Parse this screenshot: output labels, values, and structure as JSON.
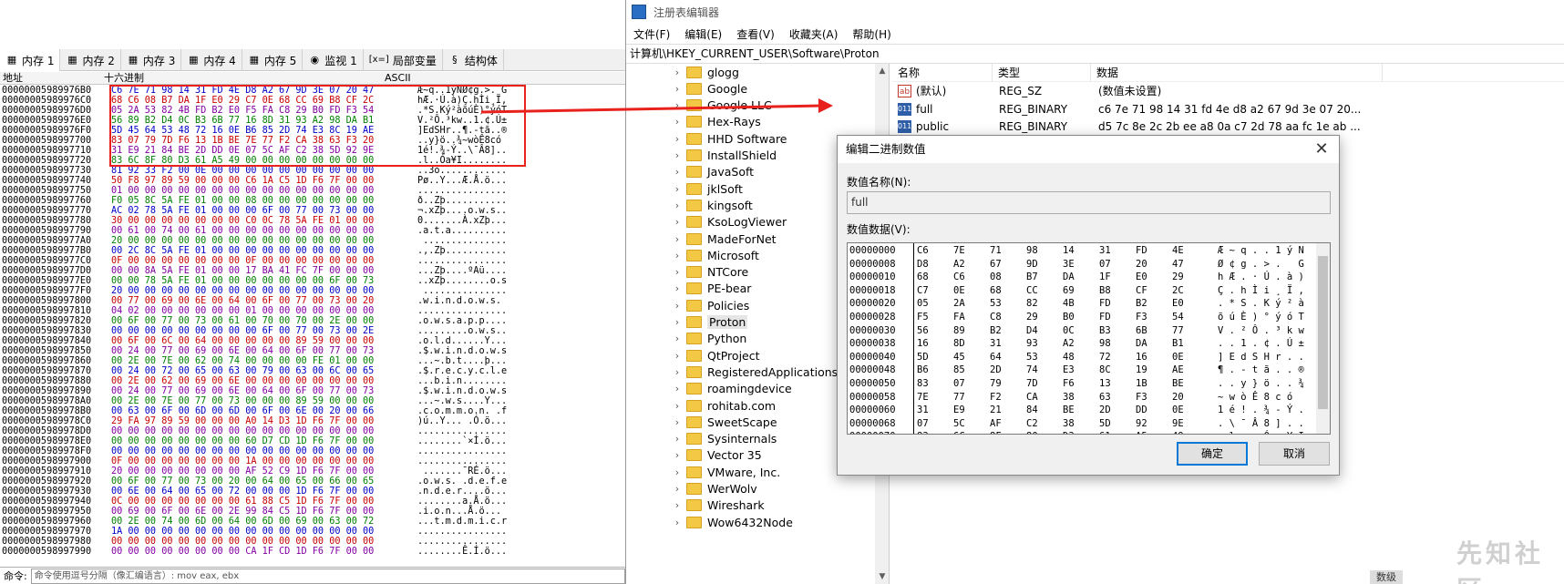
{
  "debugger": {
    "tabs": [
      {
        "label": "内存 1",
        "icon": "memory-icon",
        "active": true
      },
      {
        "label": "内存 2",
        "icon": "memory-icon"
      },
      {
        "label": "内存 3",
        "icon": "memory-icon"
      },
      {
        "label": "内存 4",
        "icon": "memory-icon"
      },
      {
        "label": "内存 5",
        "icon": "memory-icon"
      },
      {
        "label": "监视 1",
        "icon": "watch-icon"
      },
      {
        "label": "局部变量",
        "icon": "locals-icon",
        "prefix": "[x=]"
      },
      {
        "label": "结构体",
        "icon": "struct-icon"
      }
    ],
    "columns": {
      "address": "地址",
      "hex": "十六进制",
      "ascii": "ASCII"
    },
    "rows": [
      {
        "addr": "00000005989976B0",
        "hex": "C6 7E 71 98 14 31 FD 4E D8 A2 67 9D 3E 07 20 47",
        "ascii": "Æ~q..1ýNØ¢g.>. G"
      },
      {
        "addr": "00000005989976C0",
        "hex": "68 C6 08 B7 DA 1F E0 29 C7 0E 68 CC 69 B8 CF 2C",
        "ascii": "hÆ.·Ú.à)Ç.hÌi¸Ï,"
      },
      {
        "addr": "00000005989976D0",
        "hex": "05 2A 53 82 4B FD B2 E0 F5 FA C8 29 B0 FD F3 54",
        "ascii": ".*S.Ký²àõúÈ)°ýóT"
      },
      {
        "addr": "00000005989976E0",
        "hex": "56 89 B2 D4 0C B3 6B 77 16 8D 31 93 A2 98 DA B1",
        "ascii": "V.²Ô.³kw..1.¢.Ú±"
      },
      {
        "addr": "00000005989976F0",
        "hex": "5D 45 64 53 48 72 16 0E B6 85 2D 74 E3 8C 19 AE",
        "ascii": "]EdSHr..¶.-tã..®"
      },
      {
        "addr": "0000000598997700",
        "hex": "83 07 79 7D F6 13 1B BE 7E 77 F2 CA 38 63 F3 20",
        "ascii": "..y}ö..¾~wòÊ8có "
      },
      {
        "addr": "0000000598997710",
        "hex": "31 E9 21 84 BE 2D DD 0E 07 5C AF C2 38 5D 92 9E",
        "ascii": "1é!.¾-Ý..\\¯Â8].."
      },
      {
        "addr": "0000000598997720",
        "hex": "83 6C 8F 80 D3 61 A5 49 00 00 00 00 00 00 00 00",
        "ascii": ".l..Óa¥I........"
      },
      {
        "addr": "0000000598997730",
        "hex": "81 92 33 F2 00 0E 00 00 00 00 00 00 00 00 00 00",
        "ascii": "..3ò............"
      },
      {
        "addr": "0000000598997740",
        "hex": "50 F8 97 89 59 00 00 00 C6 1A C5 1D F6 7F 00 00",
        "ascii": "Pø..Y...Æ.Å.ö..."
      },
      {
        "addr": "0000000598997750",
        "hex": "01 00 00 00 00 00 00 00 00 00 00 00 00 00 00 00",
        "ascii": "................"
      },
      {
        "addr": "0000000598997760",
        "hex": "F0 05 8C 5A FE 01 00 00 08 00 00 00 00 00 00 00",
        "ascii": "ð..Zþ..........."
      },
      {
        "addr": "0000000598997770",
        "hex": "AC 02 78 5A FE 01 00 00 00 6F 00 77 00 73 00 00",
        "ascii": "¬.xZþ....o.w.s.."
      },
      {
        "addr": "0000000598997780",
        "hex": "30 00 00 00 00 00 00 00 C0 0C 78 5A FE 01 00 00",
        "ascii": "0.......À.xZþ..."
      },
      {
        "addr": "0000000598997790",
        "hex": "00 61 00 74 00 61 00 00 00 00 00 00 00 00 00 00",
        "ascii": ".a.t.a.........."
      },
      {
        "addr": "00000005989977A0",
        "hex": "20 00 00 00 00 00 00 00 00 00 00 00 00 00 00 00",
        "ascii": " ..............."
      },
      {
        "addr": "00000005989977B0",
        "hex": "00 2C 8C 5A FE 01 00 00 00 00 00 00 00 00 00 00",
        "ascii": ".,.Zþ..........."
      },
      {
        "addr": "00000005989977C0",
        "hex": "0F 00 00 00 00 00 00 00 0F 00 00 00 00 00 00 00",
        "ascii": "................"
      },
      {
        "addr": "00000005989977D0",
        "hex": "00 00 8A 5A FE 01 00 00 17 BA 41 FC 7F 00 00 00",
        "ascii": "...Zþ....ºAü...."
      },
      {
        "addr": "00000005989977E0",
        "hex": "00 00 78 5A FE 01 00 00 00 00 00 00 00 6F 00 73",
        "ascii": "..xZþ........o.s"
      },
      {
        "addr": "00000005989977F0",
        "hex": "20 00 00 00 00 00 00 00 00 00 00 00 00 00 00 00",
        "ascii": " ..............."
      },
      {
        "addr": "0000000598997800",
        "hex": "00 77 00 69 00 6E 00 64 00 6F 00 77 00 73 00 20",
        "ascii": ".w.i.n.d.o.w.s. "
      },
      {
        "addr": "0000000598997810",
        "hex": "04 02 00 00 00 00 00 00 01 00 00 00 00 00 00 00",
        "ascii": "................"
      },
      {
        "addr": "0000000598997820",
        "hex": "00 6F 00 77 00 73 00 61 00 70 00 70 00 2E 00 00",
        "ascii": ".o.w.s.a.p.p...."
      },
      {
        "addr": "0000000598997830",
        "hex": "00 00 00 00 00 00 00 00 00 6F 00 77 00 73 00 2E",
        "ascii": ".........o.w.s.."
      },
      {
        "addr": "0000000598997840",
        "hex": "00 6F 00 6C 00 64 00 00 00 00 00 89 59 00 00 00",
        "ascii": ".o.l.d......Y..."
      },
      {
        "addr": "0000000598997850",
        "hex": "00 24 00 77 00 69 00 6E 00 64 00 6F 00 77 00 73",
        "ascii": ".$.w.i.n.d.o.w.s"
      },
      {
        "addr": "0000000598997860",
        "hex": "00 2E 00 7E 00 62 00 74 00 00 00 00 FE 01 00 00",
        "ascii": "...~.b.t....þ..."
      },
      {
        "addr": "0000000598997870",
        "hex": "00 24 00 72 00 65 00 63 00 79 00 63 00 6C 00 65",
        "ascii": ".$.r.e.c.y.c.l.e"
      },
      {
        "addr": "0000000598997880",
        "hex": "00 2E 00 62 00 69 00 6E 00 00 00 00 00 00 00 00",
        "ascii": "...b.i.n........"
      },
      {
        "addr": "0000000598997890",
        "hex": "00 24 00 77 00 69 00 6E 00 64 00 6F 00 77 00 73",
        "ascii": ".$.w.i.n.d.o.w.s"
      },
      {
        "addr": "00000005989978A0",
        "hex": "00 2E 00 7E 00 77 00 73 00 00 00 89 59 00 00 00",
        "ascii": "...~.w.s....Y..."
      },
      {
        "addr": "00000005989978B0",
        "hex": "00 63 00 6F 00 6D 00 6D 00 6F 00 6E 00 20 00 66",
        "ascii": ".c.o.m.m.o.n. .f"
      },
      {
        "addr": "00000005989978C0",
        "hex": "29 FA 97 89 59 00 00 00 A0 14 D3 1D F6 7F 00 00",
        "ascii": ")ú..Y... .Ó.ö..."
      },
      {
        "addr": "00000005989978D0",
        "hex": "00 00 00 00 00 00 00 00 00 00 00 00 00 00 00 00",
        "ascii": "................"
      },
      {
        "addr": "00000005989978E0",
        "hex": "00 00 00 00 00 00 00 00 60 D7 CD 1D F6 7F 00 00",
        "ascii": "........`×Í.ö..."
      },
      {
        "addr": "00000005989978F0",
        "hex": "00 00 00 00 00 00 00 00 00 00 00 00 00 00 00 00",
        "ascii": "................"
      },
      {
        "addr": "0000000598997900",
        "hex": "0F 00 00 00 00 00 00 00 1A 00 00 00 00 00 00 00",
        "ascii": "................"
      },
      {
        "addr": "0000000598997910",
        "hex": "20 00 00 00 00 00 00 00 AF 52 C9 1D F6 7F 00 00",
        "ascii": " .......¯RÉ.ö..."
      },
      {
        "addr": "0000000598997920",
        "hex": "00 6F 00 77 00 73 00 20 00 64 00 65 00 66 00 65",
        "ascii": ".o.w.s. .d.e.f.e"
      },
      {
        "addr": "0000000598997930",
        "hex": "00 6E 00 64 00 65 00 72 00 00 00 1D F6 7F 00 00",
        "ascii": ".n.d.e.r....ö..."
      },
      {
        "addr": "0000000598997940",
        "hex": "0C 00 00 00 00 00 00 00 61 88 C5 1D F6 7F 00 00",
        "ascii": "........a.Å.ö..."
      },
      {
        "addr": "0000000598997950",
        "hex": "00 69 00 6F 00 6E 00 2E 99 84 C5 1D F6 7F 00 00",
        "ascii": ".i.o.n...Å.ö..."
      },
      {
        "addr": "0000000598997960",
        "hex": "00 2E 00 74 00 6D 00 64 00 6D 00 69 00 63 00 72",
        "ascii": "...t.m.d.m.i.c.r"
      },
      {
        "addr": "0000000598997970",
        "hex": "1A 00 00 00 00 00 00 00 00 00 00 00 00 00 00 00",
        "ascii": "................"
      },
      {
        "addr": "0000000598997980",
        "hex": "00 00 00 00 00 00 00 00 00 00 00 00 00 00 00 00",
        "ascii": "................"
      },
      {
        "addr": "0000000598997990",
        "hex": "00 00 00 00 00 00 00 00 CA 1F CD 1D F6 7F 00 00",
        "ascii": "........Ê.Í.ö..."
      }
    ],
    "command_label": "命令:",
    "command_placeholder": "命令使用逗号分隔（像汇编语言）: mov eax, ebx"
  },
  "regedit": {
    "title": "注册表编辑器",
    "menu": [
      "文件(F)",
      "编辑(E)",
      "查看(V)",
      "收藏夹(A)",
      "帮助(H)"
    ],
    "address": "计算机\\HKEY_CURRENT_USER\\Software\\Proton",
    "tree": [
      "glogg",
      "Google",
      "Google LLC",
      "Hex-Rays",
      "HHD Software",
      "InstallShield",
      "JavaSoft",
      "jklSoft",
      "kingsoft",
      "KsoLogViewer",
      "MadeForNet",
      "Microsoft",
      "NTCore",
      "PE-bear",
      "Policies",
      "Proton",
      "Python",
      "QtProject",
      "RegisteredApplications",
      "roamingdevice",
      "rohitab.com",
      "SweetScape",
      "Sysinternals",
      "Vector 35",
      "VMware, Inc.",
      "WerWolv",
      "Wireshark",
      "Wow6432Node"
    ],
    "selected_tree": "Proton",
    "list_headers": {
      "name": "名称",
      "type": "类型",
      "data": "数据"
    },
    "values": [
      {
        "name": "(默认)",
        "type": "REG_SZ",
        "data": "(数值未设置)",
        "icon": "string-value-icon"
      },
      {
        "name": "full",
        "type": "REG_BINARY",
        "data": "c6 7e 71 98 14 31 fd 4e d8 a2 67 9d 3e 07 20...",
        "icon": "binary-value-icon"
      },
      {
        "name": "public",
        "type": "REG_BINARY",
        "data": "d5 7c 8e 2c 2b ee a8 0a c7 2d 78 aa fc 1e ab ...",
        "icon": "binary-value-icon"
      }
    ]
  },
  "dialog": {
    "title": "编辑二进制数值",
    "name_label": "数值名称(N):",
    "name_value": "full",
    "data_label": "数值数据(V):",
    "hex_rows": [
      {
        "offset": "00000000",
        "bytes": [
          "C6",
          "7E",
          "71",
          "98",
          "14",
          "31",
          "FD",
          "4E"
        ],
        "ascii": "Æ ~ q . . 1 ý N"
      },
      {
        "offset": "00000008",
        "bytes": [
          "D8",
          "A2",
          "67",
          "9D",
          "3E",
          "07",
          "20",
          "47"
        ],
        "ascii": "Ø ¢ g . > .   G"
      },
      {
        "offset": "00000010",
        "bytes": [
          "68",
          "C6",
          "08",
          "B7",
          "DA",
          "1F",
          "E0",
          "29"
        ],
        "ascii": "h Æ . · Ú . à )"
      },
      {
        "offset": "00000018",
        "bytes": [
          "C7",
          "0E",
          "68",
          "CC",
          "69",
          "B8",
          "CF",
          "2C"
        ],
        "ascii": "Ç . h Ì i ¸ Ï ,"
      },
      {
        "offset": "00000020",
        "bytes": [
          "05",
          "2A",
          "53",
          "82",
          "4B",
          "FD",
          "B2",
          "E0"
        ],
        "ascii": ". * S . K ý ² à"
      },
      {
        "offset": "00000028",
        "bytes": [
          "F5",
          "FA",
          "C8",
          "29",
          "B0",
          "FD",
          "F3",
          "54"
        ],
        "ascii": "õ ú È ) ° ý ó T"
      },
      {
        "offset": "00000030",
        "bytes": [
          "56",
          "89",
          "B2",
          "D4",
          "0C",
          "B3",
          "6B",
          "77"
        ],
        "ascii": "V . ² Ô . ³ k w"
      },
      {
        "offset": "00000038",
        "bytes": [
          "16",
          "8D",
          "31",
          "93",
          "A2",
          "98",
          "DA",
          "B1"
        ],
        "ascii": ". . 1 . ¢ . Ú ±"
      },
      {
        "offset": "00000040",
        "bytes": [
          "5D",
          "45",
          "64",
          "53",
          "48",
          "72",
          "16",
          "0E"
        ],
        "ascii": "] E d S H r . ."
      },
      {
        "offset": "00000048",
        "bytes": [
          "B6",
          "85",
          "2D",
          "74",
          "E3",
          "8C",
          "19",
          "AE"
        ],
        "ascii": "¶ . - t ã . . ®"
      },
      {
        "offset": "00000050",
        "bytes": [
          "83",
          "07",
          "79",
          "7D",
          "F6",
          "13",
          "1B",
          "BE"
        ],
        "ascii": ". . y } ö . . ¾"
      },
      {
        "offset": "00000058",
        "bytes": [
          "7E",
          "77",
          "F2",
          "CA",
          "38",
          "63",
          "F3",
          "20"
        ],
        "ascii": "~ w ò Ê 8 c ó"
      },
      {
        "offset": "00000060",
        "bytes": [
          "31",
          "E9",
          "21",
          "84",
          "BE",
          "2D",
          "DD",
          "0E"
        ],
        "ascii": "1 é ! . ¾ - Ý ."
      },
      {
        "offset": "00000068",
        "bytes": [
          "07",
          "5C",
          "AF",
          "C2",
          "38",
          "5D",
          "92",
          "9E"
        ],
        "ascii": ". \\ ¯ Â 8 ] . ."
      },
      {
        "offset": "00000070",
        "bytes": [
          "83",
          "6C",
          "8F",
          "80",
          "D3",
          "61",
          "A5",
          "49"
        ],
        "ascii": ". l . . Ó a ¥ I"
      }
    ],
    "ok_label": "确定",
    "cancel_label": "取消"
  },
  "watermark": "先知社区",
  "corner_label": "数级",
  "colors": {
    "highlight_box": "#e8211c",
    "arrow": "#e8211c",
    "hex_blue": "#0000c8",
    "hex_red": "#c80000",
    "hex_purple": "#8000a0",
    "hex_green": "#008000"
  }
}
